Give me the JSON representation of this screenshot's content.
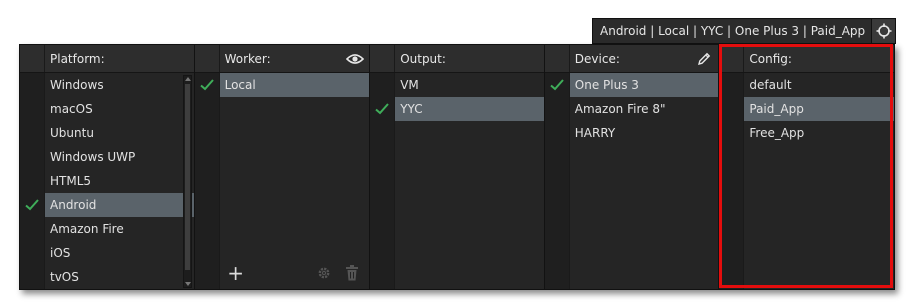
{
  "target_bar": {
    "text": "Android | Local | YYC | One Plus 3 | Paid_App",
    "target_icon": "crosshair-icon"
  },
  "columns": {
    "platform": {
      "title": "Platform:",
      "items": [
        "Windows",
        "macOS",
        "Ubuntu",
        "Windows UWP",
        "HTML5",
        "Android",
        "Amazon Fire",
        "iOS",
        "tvOS"
      ],
      "selected": "Android"
    },
    "worker": {
      "title": "Worker:",
      "header_icon": "eye-icon",
      "items": [
        "Local"
      ],
      "selected": "Local",
      "footer": {
        "add_label": "+",
        "settings_icon": "gear-icon",
        "delete_icon": "trash-icon"
      }
    },
    "output": {
      "title": "Output:",
      "items": [
        "VM",
        "YYC"
      ],
      "selected": "YYC"
    },
    "device": {
      "title": "Device:",
      "header_icon": "pencil-icon",
      "items": [
        "One Plus 3",
        "Amazon Fire 8\"",
        "HARRY"
      ],
      "selected": "One Plus 3"
    },
    "config": {
      "title": "Config:",
      "items": [
        "default",
        "Paid_App",
        "Free_App"
      ],
      "selected": "Paid_App"
    }
  },
  "colors": {
    "check": "#3fae5a",
    "selected_row": "#5a636a",
    "highlight": "#e40d0d"
  }
}
